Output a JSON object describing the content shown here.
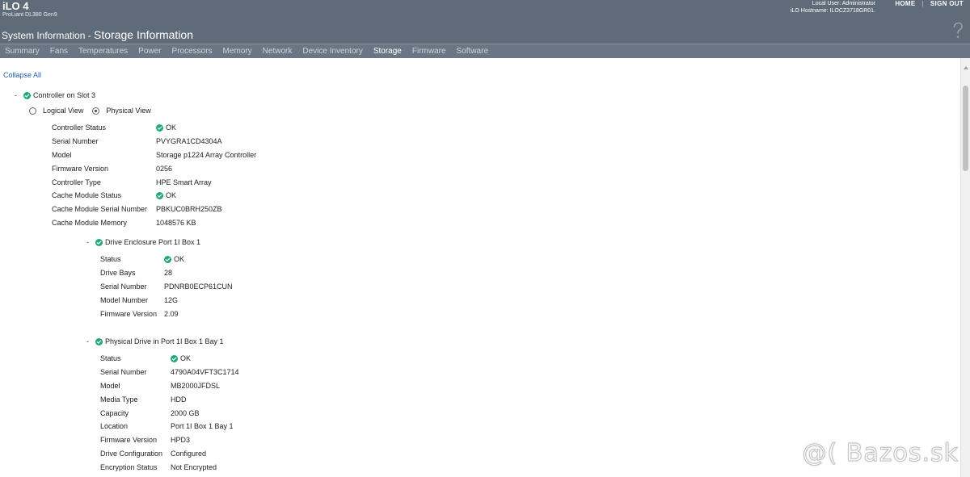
{
  "header": {
    "brand_title": "iLO 4",
    "brand_subtitle": "ProLiant DL380 Gen9",
    "local_user": "Local User: Administrator",
    "hostname": "iLO Hostname: ILOCZ3718GR01.",
    "home_label": "HOME",
    "signout_label": "SIGN OUT",
    "page_title_prefix": "System Information - ",
    "page_title_main": "Storage Information",
    "help_icon": "help-icon"
  },
  "tabs": [
    {
      "label": "Summary",
      "active": false
    },
    {
      "label": "Fans",
      "active": false
    },
    {
      "label": "Temperatures",
      "active": false
    },
    {
      "label": "Power",
      "active": false
    },
    {
      "label": "Processors",
      "active": false
    },
    {
      "label": "Memory",
      "active": false
    },
    {
      "label": "Network",
      "active": false
    },
    {
      "label": "Device Inventory",
      "active": false
    },
    {
      "label": "Storage",
      "active": true
    },
    {
      "label": "Firmware",
      "active": false
    },
    {
      "label": "Software",
      "active": false
    }
  ],
  "content": {
    "collapse_all": "Collapse All",
    "toggle_symbol": "-",
    "controller": {
      "title": "Controller on Slot 3",
      "views": {
        "logical": "Logical View",
        "physical": "Physical View",
        "selected": "physical"
      },
      "rows": [
        {
          "key": "Controller Status",
          "value": "OK",
          "ok": true
        },
        {
          "key": "Serial Number",
          "value": "PVYGRA1CD4304A",
          "ok": false
        },
        {
          "key": "Model",
          "value": "Storage p1224 Array Controller",
          "ok": false
        },
        {
          "key": "Firmware Version",
          "value": "0256",
          "ok": false
        },
        {
          "key": "Controller Type",
          "value": "HPE Smart Array",
          "ok": false
        },
        {
          "key": "Cache Module Status",
          "value": "OK",
          "ok": true
        },
        {
          "key": "Cache Module Serial Number",
          "value": "PBKUC0BRH250ZB",
          "ok": false
        },
        {
          "key": "Cache Module Memory",
          "value": "1048576 KB",
          "ok": false
        }
      ]
    },
    "enclosure": {
      "title": "Drive Enclosure Port 1I Box 1",
      "rows": [
        {
          "key": "Status",
          "value": "OK",
          "ok": true
        },
        {
          "key": "Drive Bays",
          "value": "28",
          "ok": false
        },
        {
          "key": "Serial Number",
          "value": "PDNRB0ECP61CUN",
          "ok": false
        },
        {
          "key": "Model Number",
          "value": "12G",
          "ok": false
        },
        {
          "key": "Firmware Version",
          "value": "2.09",
          "ok": false
        }
      ]
    },
    "drive": {
      "title": "Physical Drive in Port 1I Box 1 Bay 1",
      "rows": [
        {
          "key": "Status",
          "value": "OK",
          "ok": true
        },
        {
          "key": "Serial Number",
          "value": "4790A04VFT3C1714",
          "ok": false
        },
        {
          "key": "Model",
          "value": "MB2000JFDSL",
          "ok": false
        },
        {
          "key": "Media Type",
          "value": "HDD",
          "ok": false
        },
        {
          "key": "Capacity",
          "value": "2000 GB",
          "ok": false
        },
        {
          "key": "Location",
          "value": "Port 1I Box 1 Bay 1",
          "ok": false
        },
        {
          "key": "Firmware Version",
          "value": "HPD3",
          "ok": false
        },
        {
          "key": "Drive Configuration",
          "value": "Configured",
          "ok": false
        },
        {
          "key": "Encryption Status",
          "value": "Not Encrypted",
          "ok": false
        }
      ]
    }
  },
  "watermark": "@( Bazos.sk",
  "colors": {
    "header_bg": "#5f6b78",
    "tab_bg": "#6a7683",
    "ok_green": "#1fa67a",
    "link_blue": "#2a5db0"
  }
}
